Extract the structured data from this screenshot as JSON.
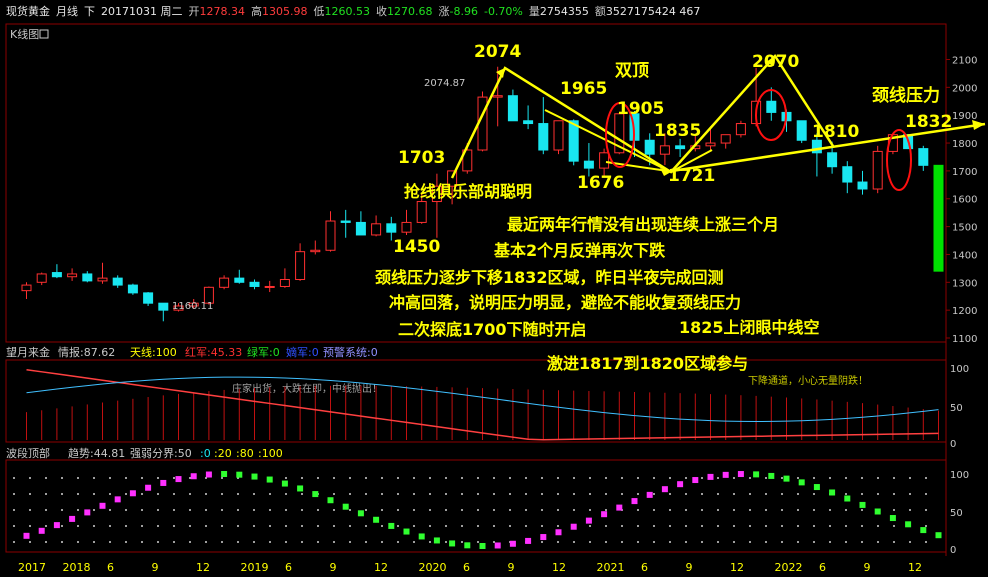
{
  "header": {
    "instrument": "现货黄金",
    "period": "月线",
    "direction": "下",
    "date": "20171031 周二",
    "open_label": "开",
    "open": "1278.34",
    "high_label": "高",
    "high": "1305.98",
    "low_label": "低",
    "low": "1260.53",
    "close_label": "收",
    "close": "1270.68",
    "change_label": "涨",
    "change": "-8.96",
    "change_pct": "-0.70%",
    "volume_label": "量",
    "volume": "2754355",
    "amount_label": "额",
    "amount": "3527175424 467"
  },
  "main_panel": {
    "title": "K线图",
    "title_icon": "restore-icon",
    "right_axis_ticks": [
      "2100",
      "2000",
      "1900",
      "1800",
      "1700",
      "1600",
      "1500",
      "1400",
      "1300",
      "1200",
      "1100"
    ],
    "labels": {
      "p2074": "2074",
      "p2074_87": "2074.87",
      "p1965": "1965",
      "p1905": "1905",
      "double_top": "双顶",
      "p2070": "2070",
      "neck_pressure": "颈线压力",
      "p1832": "1832",
      "p1835": "1835",
      "p1810": "1810",
      "p1703": "1703",
      "p1676": "1676",
      "p1721": "1721",
      "p1450": "1450",
      "p1160": "1160.11",
      "author": "抢线俱乐部胡聪明"
    },
    "commentary": [
      "最近两年行情没有出现连续上涨三个月",
      "基本2个月反弹再次下跌",
      "颈线压力逐步下移1832区域，昨日半夜完成回测",
      "冲高回落，说明压力明显，避险不能收复颈线压力",
      "二次探底1700下随时开启",
      "1825上闭眼中线空",
      "激进1817到1820区域参与"
    ]
  },
  "indicator1": {
    "name": "望月来金",
    "intel_label": "情报:87.62",
    "sky_army": "天线:100",
    "red_army": "红军:45.33",
    "green_army": "绿军:0",
    "loyal_army": "嫡军:0",
    "warning": "预警系统:0",
    "note_left": "庄家出货，大跌在即，中线抛出！",
    "note_right": "下降通道，小心无量阴跌！",
    "ticks": [
      "100",
      "50",
      "0"
    ]
  },
  "indicator2": {
    "name": "波段顶部",
    "trend_label": "趋势:44.81",
    "divider_label": "强弱分界:50",
    "v0": ":0",
    "v20": ":20",
    "v80": ":80",
    "v100": ":100",
    "ticks": [
      "100",
      "50",
      "0"
    ]
  },
  "x_axis": {
    "labels": [
      "2017",
      "2018",
      "6",
      "9",
      "12",
      "2019",
      "6",
      "9",
      "12",
      "2020",
      "6",
      "9",
      "12",
      "2021",
      "6",
      "9",
      "12",
      "2022",
      "6",
      "9",
      "12"
    ]
  },
  "colors": {
    "up": "#ff3030",
    "down": "#19e6f0",
    "annotation": "#ffff00",
    "circle": "#ff1010",
    "big_down": "#00e000",
    "grid": "#8c0000"
  },
  "chart_data": {
    "type": "candlestick",
    "title": "",
    "ylim": [
      1100,
      2170
    ],
    "candles": [
      {
        "o": 1270,
        "h": 1300,
        "l": 1240,
        "c": 1290
      },
      {
        "o": 1300,
        "h": 1335,
        "l": 1290,
        "c": 1330
      },
      {
        "o": 1335,
        "h": 1365,
        "l": 1315,
        "c": 1320
      },
      {
        "o": 1320,
        "h": 1350,
        "l": 1305,
        "c": 1330
      },
      {
        "o": 1330,
        "h": 1340,
        "l": 1300,
        "c": 1305
      },
      {
        "o": 1305,
        "h": 1370,
        "l": 1295,
        "c": 1315
      },
      {
        "o": 1315,
        "h": 1325,
        "l": 1280,
        "c": 1290
      },
      {
        "o": 1290,
        "h": 1295,
        "l": 1255,
        "c": 1262
      },
      {
        "o": 1262,
        "h": 1265,
        "l": 1215,
        "c": 1225
      },
      {
        "o": 1225,
        "h": 1225,
        "l": 1160,
        "c": 1200
      },
      {
        "o": 1200,
        "h": 1225,
        "l": 1195,
        "c": 1215
      },
      {
        "o": 1215,
        "h": 1240,
        "l": 1205,
        "c": 1225
      },
      {
        "o": 1225,
        "h": 1285,
        "l": 1220,
        "c": 1282
      },
      {
        "o": 1282,
        "h": 1325,
        "l": 1275,
        "c": 1315
      },
      {
        "o": 1315,
        "h": 1345,
        "l": 1295,
        "c": 1300
      },
      {
        "o": 1300,
        "h": 1310,
        "l": 1275,
        "c": 1285
      },
      {
        "o": 1285,
        "h": 1305,
        "l": 1265,
        "c": 1285
      },
      {
        "o": 1285,
        "h": 1350,
        "l": 1280,
        "c": 1310
      },
      {
        "o": 1310,
        "h": 1440,
        "l": 1305,
        "c": 1410
      },
      {
        "o": 1410,
        "h": 1450,
        "l": 1400,
        "c": 1415
      },
      {
        "o": 1415,
        "h": 1555,
        "l": 1410,
        "c": 1520
      },
      {
        "o": 1520,
        "h": 1560,
        "l": 1460,
        "c": 1515
      },
      {
        "o": 1515,
        "h": 1555,
        "l": 1490,
        "c": 1470
      },
      {
        "o": 1470,
        "h": 1540,
        "l": 1465,
        "c": 1510
      },
      {
        "o": 1510,
        "h": 1535,
        "l": 1450,
        "c": 1480
      },
      {
        "o": 1480,
        "h": 1560,
        "l": 1470,
        "c": 1515
      },
      {
        "o": 1515,
        "h": 1620,
        "l": 1510,
        "c": 1590
      },
      {
        "o": 1590,
        "h": 1690,
        "l": 1460,
        "c": 1645
      },
      {
        "o": 1645,
        "h": 1700,
        "l": 1580,
        "c": 1700
      },
      {
        "o": 1700,
        "h": 1800,
        "l": 1690,
        "c": 1775
      },
      {
        "o": 1775,
        "h": 1985,
        "l": 1770,
        "c": 1965
      },
      {
        "o": 1965,
        "h": 2074,
        "l": 1860,
        "c": 1970
      },
      {
        "o": 1970,
        "h": 1992,
        "l": 1900,
        "c": 1880
      },
      {
        "o": 1880,
        "h": 1935,
        "l": 1850,
        "c": 1870
      },
      {
        "o": 1870,
        "h": 1965,
        "l": 1760,
        "c": 1775
      },
      {
        "o": 1775,
        "h": 1880,
        "l": 1760,
        "c": 1880
      },
      {
        "o": 1880,
        "h": 1885,
        "l": 1720,
        "c": 1735
      },
      {
        "o": 1735,
        "h": 1800,
        "l": 1680,
        "c": 1710
      },
      {
        "o": 1710,
        "h": 1780,
        "l": 1676,
        "c": 1765
      },
      {
        "o": 1765,
        "h": 1905,
        "l": 1760,
        "c": 1905
      },
      {
        "o": 1905,
        "h": 1915,
        "l": 1750,
        "c": 1810
      },
      {
        "o": 1810,
        "h": 1835,
        "l": 1720,
        "c": 1760
      },
      {
        "o": 1760,
        "h": 1835,
        "l": 1721,
        "c": 1790
      },
      {
        "o": 1790,
        "h": 1815,
        "l": 1750,
        "c": 1780
      },
      {
        "o": 1780,
        "h": 1830,
        "l": 1770,
        "c": 1790
      },
      {
        "o": 1790,
        "h": 1860,
        "l": 1770,
        "c": 1800
      },
      {
        "o": 1800,
        "h": 1830,
        "l": 1780,
        "c": 1830
      },
      {
        "o": 1830,
        "h": 1880,
        "l": 1820,
        "c": 1870
      },
      {
        "o": 1870,
        "h": 2070,
        "l": 1860,
        "c": 1950
      },
      {
        "o": 1950,
        "h": 2000,
        "l": 1880,
        "c": 1910
      },
      {
        "o": 1910,
        "h": 1920,
        "l": 1840,
        "c": 1880
      },
      {
        "o": 1880,
        "h": 1880,
        "l": 1800,
        "c": 1810
      },
      {
        "o": 1810,
        "h": 1835,
        "l": 1680,
        "c": 1765
      },
      {
        "o": 1765,
        "h": 1805,
        "l": 1690,
        "c": 1715
      },
      {
        "o": 1715,
        "h": 1735,
        "l": 1620,
        "c": 1660
      },
      {
        "o": 1660,
        "h": 1700,
        "l": 1615,
        "c": 1635
      },
      {
        "o": 1635,
        "h": 1790,
        "l": 1620,
        "c": 1770
      },
      {
        "o": 1770,
        "h": 1830,
        "l": 1760,
        "c": 1830
      },
      {
        "o": 1830,
        "h": 1832,
        "l": 1780,
        "c": 1780
      },
      {
        "o": 1780,
        "h": 1790,
        "l": 1700,
        "c": 1720
      },
      {
        "o": 1720,
        "h": 1720,
        "l": 1340,
        "c": 1340
      }
    ]
  }
}
